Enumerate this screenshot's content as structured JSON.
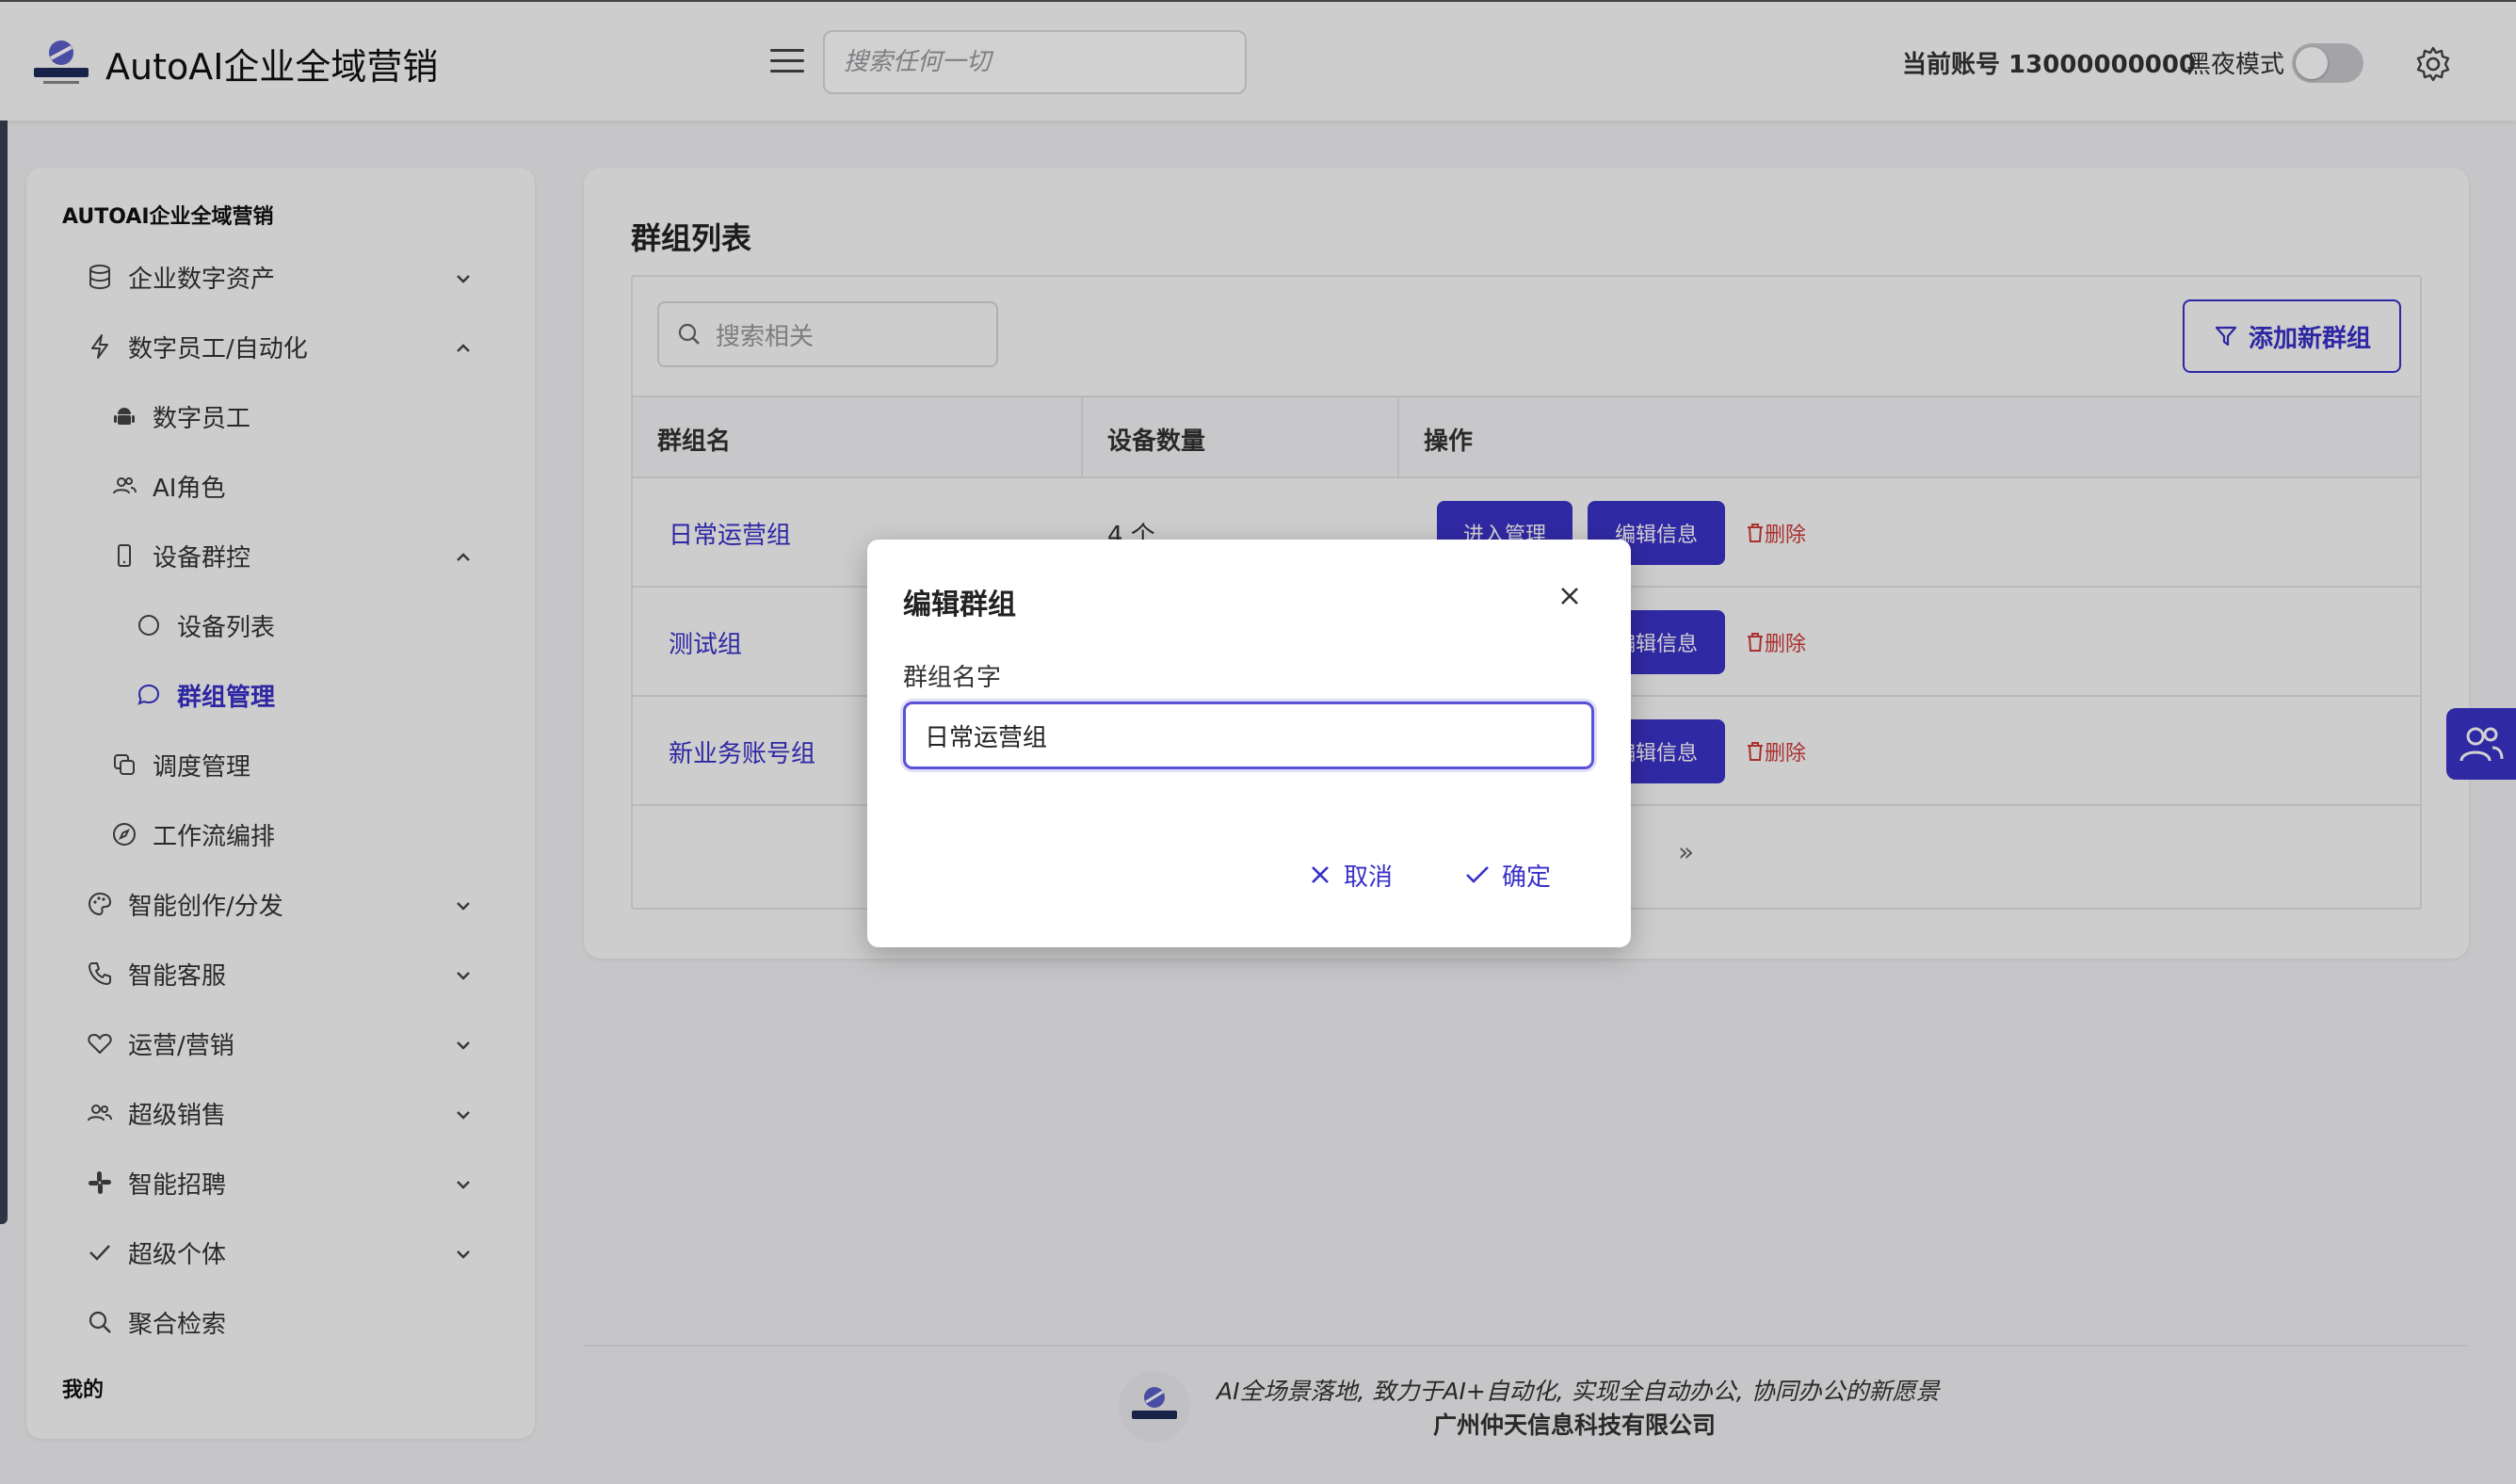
{
  "header": {
    "app_title": "AutoAI企业全域营销",
    "search_placeholder": "搜索任何一切",
    "account": "当前账号 13000000000",
    "dark_mode_label": "黑夜模式",
    "dark_mode_on": false
  },
  "sidebar": {
    "brand": "AUTOAI企业全域营销",
    "items": [
      {
        "label": "企业数字资产",
        "icon": "database-icon",
        "expand": "down"
      },
      {
        "label": "数字员工/自动化",
        "icon": "bolt-icon",
        "expand": "up"
      },
      {
        "label": "数字员工",
        "icon": "android-icon"
      },
      {
        "label": "AI角色",
        "icon": "users-icon"
      },
      {
        "label": "设备群控",
        "icon": "phone-icon",
        "expand": "up"
      },
      {
        "label": "设备列表",
        "icon": "circle-icon"
      },
      {
        "label": "群组管理",
        "icon": "chat-icon",
        "active": true
      },
      {
        "label": "调度管理",
        "icon": "copy-icon"
      },
      {
        "label": "工作流编排",
        "icon": "compass-icon"
      },
      {
        "label": "智能创作/分发",
        "icon": "palette-icon",
        "expand": "down"
      },
      {
        "label": "智能客服",
        "icon": "phone-call-icon",
        "expand": "down"
      },
      {
        "label": "运营/营销",
        "icon": "heart-icon",
        "expand": "down"
      },
      {
        "label": "超级销售",
        "icon": "people-icon",
        "expand": "down"
      },
      {
        "label": "智能招聘",
        "icon": "slack-icon",
        "expand": "down"
      },
      {
        "label": "超级个体",
        "icon": "check-icon",
        "expand": "down"
      },
      {
        "label": "聚合检索",
        "icon": "search-icon"
      }
    ],
    "mine": "我的"
  },
  "main": {
    "title": "群组列表",
    "search_placeholder": "搜索相关",
    "add_button": "添加新群组",
    "columns": [
      "群组名",
      "设备数量",
      "操作"
    ],
    "rows": [
      {
        "name": "日常运营组",
        "count": "4 个"
      },
      {
        "name": "测试组",
        "count": ""
      },
      {
        "name": "新业务账号组",
        "count": ""
      }
    ],
    "actions": {
      "enter": "进入管理",
      "edit": "编辑信息",
      "delete": "删除"
    },
    "pager_next": "»"
  },
  "modal": {
    "title": "编辑群组",
    "field_label": "群组名字",
    "field_value": "日常运营组",
    "cancel": "取消",
    "confirm": "确定"
  },
  "footer": {
    "slogan": "AI全场景落地, 致力于AI+自动化, 实现全自动办公, 协同办公的新愿景",
    "company": "广州仲天信息科技有限公司"
  },
  "colors": {
    "accent": "#3730c8",
    "danger": "#d03a3a",
    "background": "#f2f2f4"
  }
}
